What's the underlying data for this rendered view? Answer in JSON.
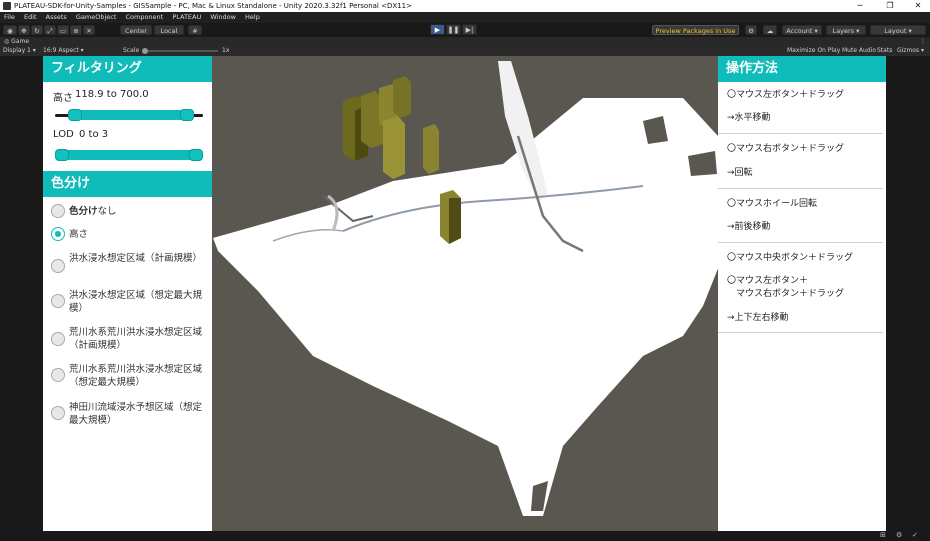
{
  "window": {
    "title": "PLATEAU-SDK-for-Unity-Samples - GISSample - PC, Mac & Linux Standalone - Unity 2020.3.32f1 Personal <DX11>",
    "minimize": "─",
    "maximize": "❐",
    "close": "✕"
  },
  "menu": [
    "File",
    "Edit",
    "Assets",
    "GameObject",
    "Component",
    "PLATEAU",
    "Window",
    "Help"
  ],
  "toolbar": {
    "center_label": "Center",
    "local_label": "Local",
    "preview_packages": "Preview Packages in Use ▾",
    "account": "Account ▾",
    "layers": "Layers ▾",
    "layout": "Layout ▾"
  },
  "game_tab": {
    "label": "Game",
    "display": "Display 1 ▾",
    "aspect": "16:9 Aspect ▾",
    "scale_label": "Scale",
    "scale_value": "1x",
    "maximize_on_play": "Maximize On Play",
    "mute_audio": "Mute Audio",
    "stats": "Stats",
    "gizmos": "Gizmos ▾"
  },
  "filter_panel": {
    "title": "フィルタリング",
    "height_label": "高さ",
    "height_value": "118.9 to 700.0",
    "height_range": [
      0.1,
      0.93
    ],
    "lod_label": "LOD",
    "lod_value": "0 to 3",
    "lod_range": [
      0.0,
      1.0
    ]
  },
  "color_panel": {
    "title": "色分け",
    "options": [
      {
        "label": "色分けなし",
        "bold": "色分け",
        "rest": "なし",
        "selected": false
      },
      {
        "label": "高さ",
        "selected": true
      },
      {
        "label": "洪水浸水想定区域（計画規模）",
        "selected": false
      },
      {
        "label": "洪水浸水想定区域（想定最大規模）",
        "selected": false
      },
      {
        "label": "荒川水系荒川洪水浸水想定区域（計画規模）",
        "selected": false
      },
      {
        "label": "荒川水系荒川洪水浸水想定区域（想定最大規模）",
        "selected": false
      },
      {
        "label": "神田川流域浸水予想区域（想定最大規模）",
        "selected": false
      }
    ]
  },
  "controls_panel": {
    "title": "操作方法",
    "lines": [
      "〇マウス左ボタン＋ドラッグ",
      "→水平移動",
      "〇マウス右ボタン＋ドラッグ",
      "→回転",
      "〇マウスホイール回転",
      "→前後移動",
      "〇マウス中央ボタン＋ドラッグ",
      "〇マウス左ボタン＋",
      "　マウス右ボタン＋ドラッグ",
      "→上下左右移動"
    ]
  }
}
